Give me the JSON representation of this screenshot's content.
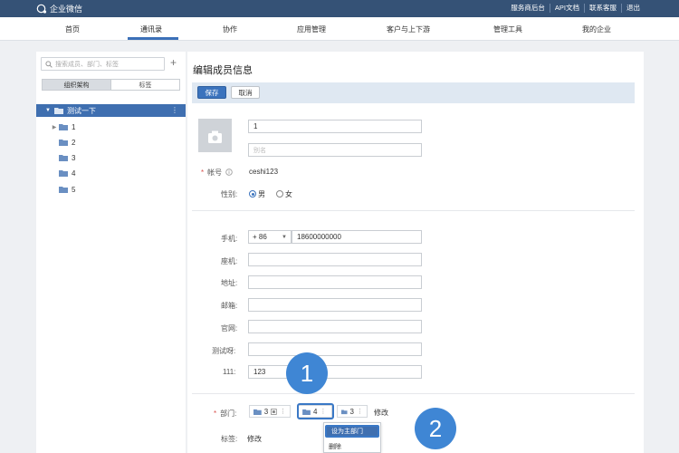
{
  "topbar": {
    "app_name": "企业微信",
    "links": [
      "服务商后台",
      "API文档",
      "联系客服",
      "退出"
    ]
  },
  "nav": {
    "items": [
      "首页",
      "通讯录",
      "协作",
      "应用管理",
      "客户与上下游",
      "管理工具",
      "我的企业"
    ],
    "active_index": 1
  },
  "sidebar": {
    "search_placeholder": "搜索成员、部门、标签",
    "tabs": [
      "组织架构",
      "标签"
    ],
    "root": "测试一下",
    "items": [
      "1",
      "2",
      "3",
      "4",
      "5"
    ]
  },
  "editor": {
    "title": "编辑成员信息",
    "save_label": "保存",
    "cancel_label": "取消",
    "name_value": "1",
    "alias_placeholder": "别名",
    "account_label": "帐号",
    "account_value": "ceshi123",
    "gender_label": "性别:",
    "gender_male": "男",
    "gender_female": "女",
    "phone_label": "手机:",
    "phone_code": "+ 86",
    "phone_value": "18600000000",
    "landline_label": "座机:",
    "address_label": "地址:",
    "email_label": "邮箱:",
    "website_label": "官网:",
    "test_label": "测试呀:",
    "custom_111_label": "111:",
    "custom_111_value": "123",
    "dept_label": "部门:",
    "dept_tags": [
      "3",
      "4",
      "3"
    ],
    "dept_edit": "修改",
    "tag_label": "标签:",
    "tag_edit": "修改",
    "menu": [
      "设为主部门",
      "删除"
    ]
  },
  "badges": [
    "1",
    "2"
  ],
  "colors": {
    "topbar": "#355276",
    "accent": "#3b73bd",
    "badge": "#3f86d4"
  }
}
